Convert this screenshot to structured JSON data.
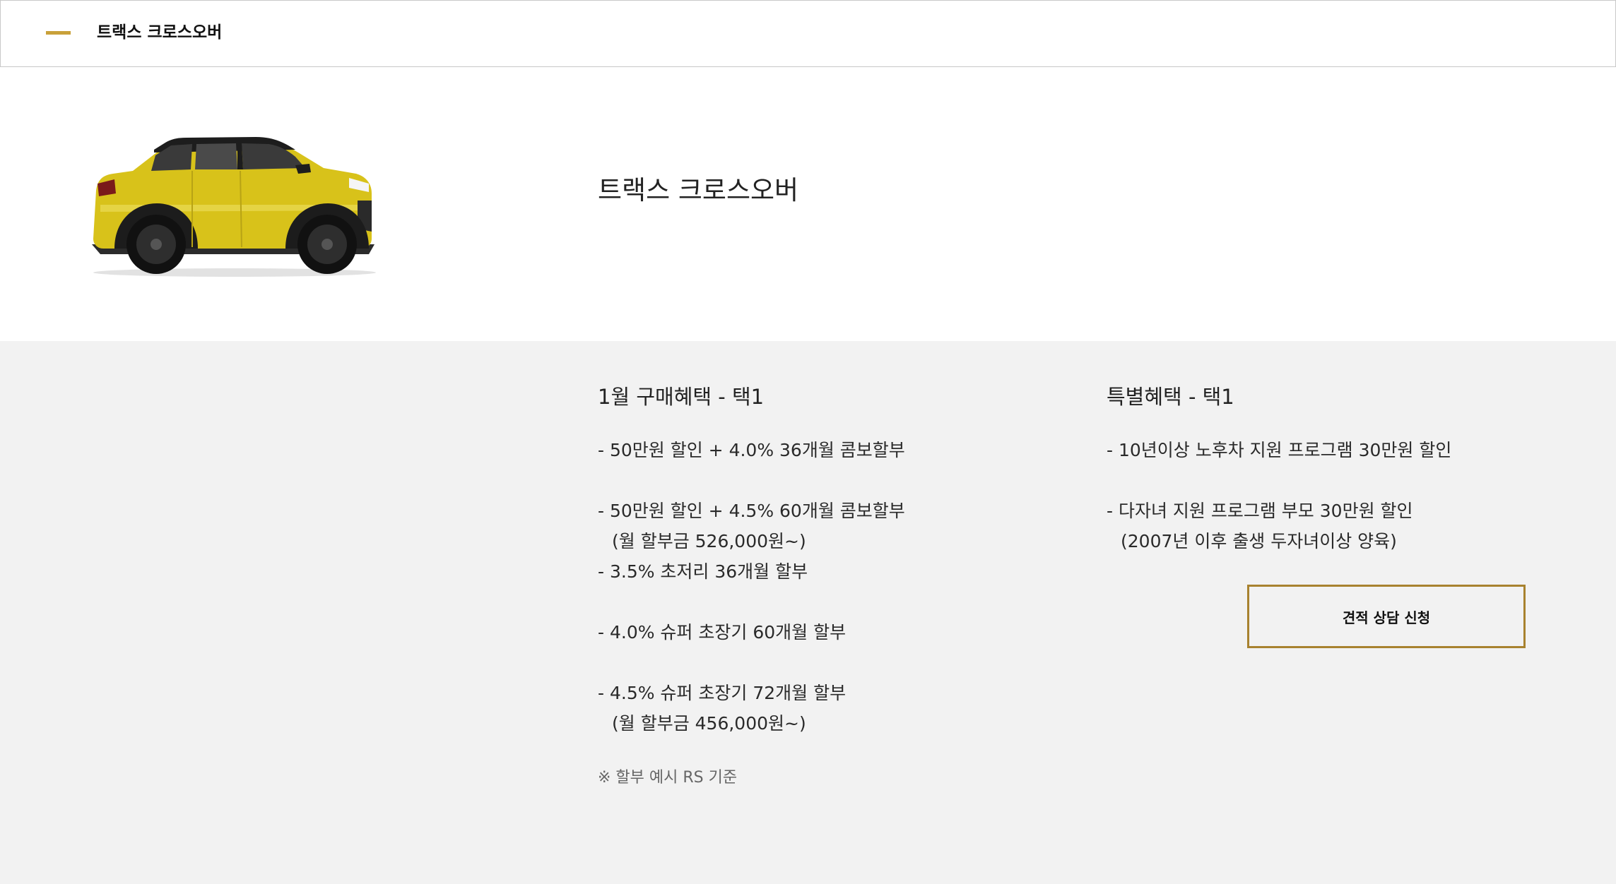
{
  "header": {
    "title": "트랙스 크로스오버",
    "accent_color": "#c9a13a"
  },
  "hero": {
    "model_name": "트랙스 크로스오버",
    "car_image": "yellow-suv-side-view",
    "car_color": "#d8c21a"
  },
  "monthly_benefits": {
    "heading": "1월 구매혜택 - 택1",
    "lines": [
      "- 50만원 할인 + 4.0% 36개월 콤보할부",
      "",
      "- 50만원 할인 + 4.5% 60개월 콤보할부",
      "(월 할부금 526,000원~)",
      "- 3.5% 초저리 36개월 할부",
      "",
      "- 4.0% 슈퍼 초장기 60개월 할부",
      "",
      "- 4.5% 슈퍼 초장기 72개월 할부",
      "(월 할부금 456,000원~)"
    ],
    "note": "※ 할부 예시 RS 기준"
  },
  "special_benefits": {
    "heading": "특별혜택 - 택1",
    "lines": [
      "- 10년이상 노후차 지원 프로그램 30만원 할인",
      "",
      "- 다자녀 지원 프로그램 부모 30만원 할인",
      "(2007년 이후 출생 두자녀이상 양육)"
    ]
  },
  "cta": {
    "label": "견적 상담 신청",
    "border_color": "#a8822f"
  }
}
